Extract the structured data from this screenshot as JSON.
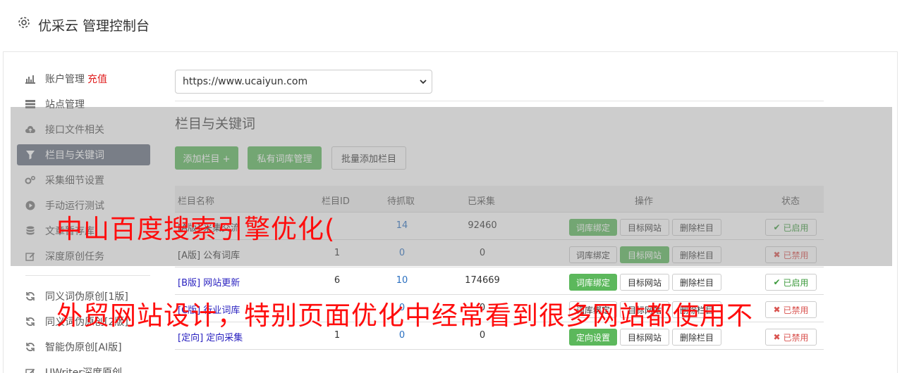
{
  "header": {
    "title": "优采云 管理控制台",
    "icon": "gear-icon"
  },
  "sidebar": {
    "items": [
      {
        "label": "账户管理",
        "extra": "充值",
        "icon": "bar-chart-icon"
      },
      {
        "label": "站点管理",
        "icon": "server-icon"
      },
      {
        "label": "接口文件相关",
        "icon": "cloud-upload-icon"
      },
      {
        "label": "栏目与关键词",
        "icon": "filter-icon",
        "active": true
      },
      {
        "label": "采集细节设置",
        "icon": "gears-icon"
      },
      {
        "label": "手动运行测试",
        "icon": "play-circle-icon"
      },
      {
        "label": "文章暂存库",
        "icon": "database-icon"
      },
      {
        "label": "深度原创任务",
        "icon": "edit-icon"
      }
    ],
    "items2": [
      {
        "label": "同义词伪原创[1版]",
        "icon": "refresh-icon"
      },
      {
        "label": "同义词伪原创[2版]",
        "icon": "refresh-icon"
      },
      {
        "label": "智能伪原创[AI版]",
        "icon": "refresh-icon"
      },
      {
        "label": "UWriter深度原创",
        "icon": "edit-icon"
      }
    ]
  },
  "main": {
    "site_select": "https://www.ucaiyun.com",
    "section_title": "栏目与关键词",
    "buttons": {
      "add_column": "添加栏目 +",
      "private_lib": "私有词库管理",
      "batch_add": "批量添加栏目"
    },
    "table": {
      "headers": [
        "栏目名称",
        "栏目ID",
        "待抓取",
        "已采集",
        "操作",
        "状态"
      ],
      "rows": [
        {
          "name": "[A版] 采集交流",
          "id": "",
          "pending": "14",
          "collected": "92460",
          "op1": "词库绑定",
          "op2": "目标网站",
          "op3": "删除栏目",
          "status": "已启用"
        },
        {
          "name": "[A版] 公有词库",
          "id": "1",
          "pending": "0",
          "collected": "0",
          "op1": "词库绑定",
          "op2": "目标网站",
          "op3": "删除栏目",
          "status": "已禁用"
        },
        {
          "name": "[B版] 网站更新",
          "id": "6",
          "pending": "10",
          "collected": "174669",
          "op1": "词库绑定",
          "op2": "目标网站",
          "op3": "删除栏目",
          "status": "已启用"
        },
        {
          "name": "[C版] 行业词库",
          "id": "",
          "pending": "0",
          "collected": "0",
          "op1": "词库绑定",
          "op2": "目标网站",
          "op3": "删除栏目",
          "status": "已禁用"
        },
        {
          "name": "[定向] 定向采集",
          "id": "1",
          "pending": "0",
          "collected": "0",
          "op1": "定向设置",
          "op2": "目标网站",
          "op3": "删除栏目",
          "status": "已禁用"
        }
      ]
    }
  },
  "watermark": {
    "line1": "中山百度搜索引擎优化(",
    "line2": "外贸网站设计，特别页面优化中经常看到很多网站都使用不"
  }
}
